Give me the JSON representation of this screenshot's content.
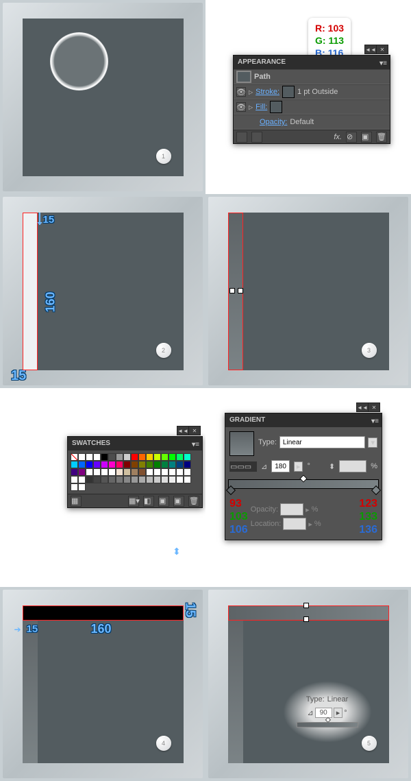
{
  "steps": {
    "s1": "1",
    "s2": "2",
    "s3": "3",
    "s4": "4",
    "s5": "5"
  },
  "rgb_callout": {
    "r": "R: 103",
    "g": "G: 113",
    "b": "B: 116"
  },
  "appearance_panel": {
    "title": "APPEARANCE",
    "path_label": "Path",
    "stroke_label": "Stroke:",
    "stroke_value": "1 pt  Outside",
    "fill_label": "Fill:",
    "opacity_label": "Opacity:",
    "opacity_value": "Default",
    "fx_label": "fx."
  },
  "dims": {
    "fifteen": "15",
    "onesixty": "160"
  },
  "swatches_panel": {
    "title": "SWATCHES",
    "colors": [
      "#ffffff",
      "#ffffff",
      "#000000",
      "#4d4d4d",
      "#999999",
      "#cccccc",
      "#ff0000",
      "#ff6600",
      "#ffcc00",
      "#ccff00",
      "#66ff00",
      "#00ff00",
      "#00ff66",
      "#00ffcc",
      "#00ccff",
      "#0066ff",
      "#0000ff",
      "#6600ff",
      "#cc00ff",
      "#ff00cc",
      "#ff0066",
      "#800000",
      "#804000",
      "#808000",
      "#408000",
      "#008000",
      "#008040",
      "#008080",
      "#004080",
      "#000080",
      "#400080",
      "#800080",
      "#ffffff",
      "#ffffff",
      "#ffffff",
      "#ffffff",
      "#f0e0d0",
      "#d0c0a0",
      "#a08060",
      "#805030",
      "#ffffff",
      "#ffffff",
      "#ffffff",
      "#ffffff",
      "#ffffff",
      "#ffffff",
      "#ffffff",
      "#ffffff",
      "#333333",
      "#444444",
      "#555555",
      "#666666",
      "#777777",
      "#888888",
      "#999999",
      "#aaaaaa",
      "#bbbbbb",
      "#cccccc",
      "#dddddd",
      "#eeeeee",
      "#ffffff",
      "#ffffff",
      "#ffffff",
      "#ffffff"
    ]
  },
  "gradient_panel": {
    "title": "GRADIENT",
    "type_label": "Type:",
    "type_value": "Linear",
    "angle": "180",
    "degree": "°",
    "opacity_label": "Opacity:",
    "location_label": "Location:",
    "pct": "%",
    "left_rgb": {
      "r": "93",
      "g": "103",
      "b": "106"
    },
    "right_rgb": {
      "r": "123",
      "g": "133",
      "b": "136"
    }
  },
  "spotlight": {
    "type_label": "Type:",
    "type_value": "Linear",
    "angle": "90",
    "degree": "°"
  }
}
